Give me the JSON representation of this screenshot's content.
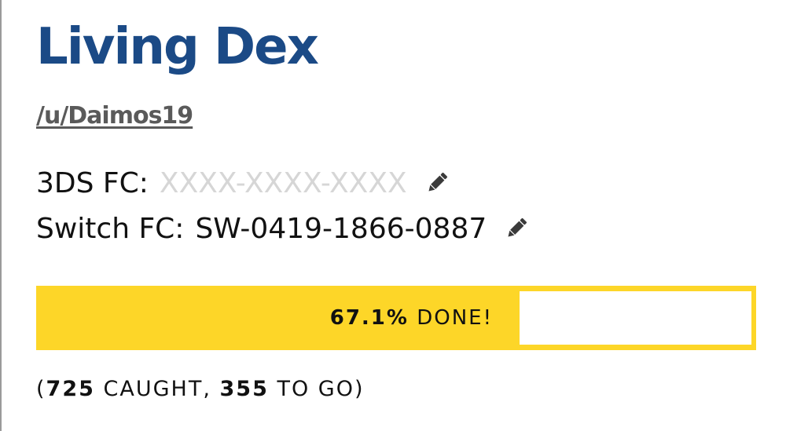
{
  "page": {
    "title": "Living Dex",
    "title_color": "#1b4a86",
    "user_link": "/u/Daimos19"
  },
  "friend_codes": {
    "three_ds": {
      "label": "3DS FC:",
      "value": "",
      "placeholder": "XXXX-XXXX-XXXX",
      "edit_icon": "pencil-icon"
    },
    "switch": {
      "label": "Switch FC:",
      "value": "SW-0419-1866-0887",
      "edit_icon": "pencil-icon"
    }
  },
  "progress": {
    "fraction": 0.671,
    "percent_text": "67.1%",
    "done_text": "DONE!",
    "bar_color": "#fdd628"
  },
  "counts": {
    "open": "(",
    "caught": "725",
    "caught_label": "CAUGHT,",
    "to_go": "355",
    "to_go_label": "TO GO",
    "close": ")"
  }
}
